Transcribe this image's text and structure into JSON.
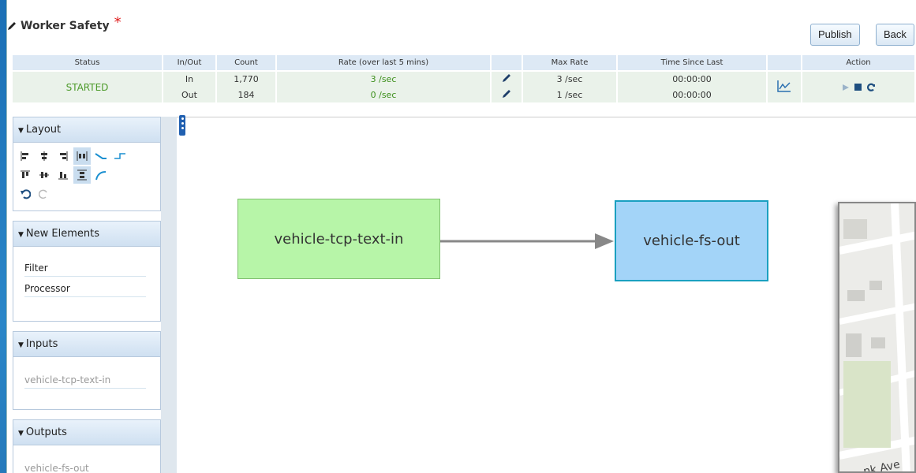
{
  "window": {
    "title": "Worker Safety",
    "unsaved_marker": "*"
  },
  "toolbar": {
    "publish_label": "Publish",
    "back_label": "Back"
  },
  "stats": {
    "headers": [
      "Status",
      "In/Out",
      "Count",
      "Rate (over last 5 mins)",
      "",
      "Max Rate",
      "Time Since Last",
      "",
      "Action"
    ],
    "status": "STARTED",
    "rows": [
      {
        "direction": "In",
        "count": "1,770",
        "rate": "3 /sec",
        "max_rate": "3 /sec",
        "time_since_last": "00:00:00"
      },
      {
        "direction": "Out",
        "count": "184",
        "rate": "0 /sec",
        "max_rate": "1 /sec",
        "time_since_last": "00:00:00"
      }
    ],
    "icons": {
      "edit": "pencil-icon",
      "chart": "line-chart-icon",
      "play": "play-icon",
      "stop": "stop-icon",
      "refresh": "refresh-icon"
    }
  },
  "sidebar": {
    "layout": {
      "title": "Layout"
    },
    "new_elements": {
      "title": "New Elements",
      "items": [
        "Filter",
        "Processor"
      ]
    },
    "inputs": {
      "title": "Inputs",
      "items": [
        "vehicle-tcp-text-in"
      ]
    },
    "outputs": {
      "title": "Outputs",
      "items": [
        "vehicle-fs-out"
      ]
    }
  },
  "canvas": {
    "nodes": {
      "input": "vehicle-tcp-text-in",
      "output": "vehicle-fs-out"
    }
  },
  "map": {
    "street_label": "nk Ave"
  },
  "colors": {
    "started": "#4c9a2a",
    "input_node": "#b7f5a8",
    "output_node": "#a3d4f8",
    "asterisk": "#e02020"
  }
}
